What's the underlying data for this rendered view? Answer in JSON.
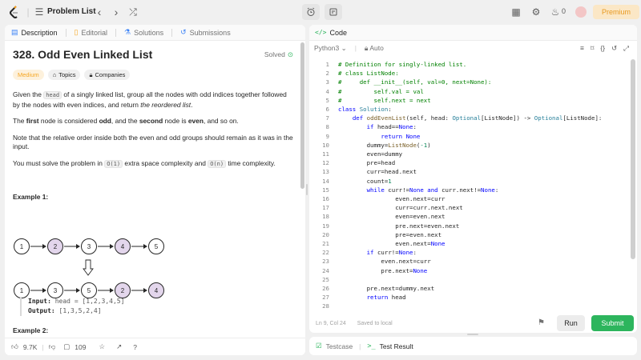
{
  "topbar": {
    "problem_list": "Problem List",
    "streak_count": "0",
    "premium": "Premium"
  },
  "left_tabs": [
    "Description",
    "Editorial",
    "Solutions",
    "Submissions"
  ],
  "problem": {
    "title": "328. Odd Even Linked List",
    "solved": "Solved",
    "difficulty": "Medium",
    "topics": "Topics",
    "companies": "Companies",
    "p1_a": "Given the ",
    "p1_code": "head",
    "p1_b": " of a singly linked list, group all the nodes with odd indices together followed by the nodes with even indices, and return ",
    "p1_em": "the reordered list",
    "p1_c": ".",
    "p2_a": "The ",
    "p2_b1": "first",
    "p2_b": " node is considered ",
    "p2_b2": "odd",
    "p2_c": ", and the ",
    "p2_b3": "second",
    "p2_d": " node is ",
    "p2_b4": "even",
    "p2_e": ", and so on.",
    "p3": "Note that the relative order inside both the even and odd groups should remain as it was in the input.",
    "p4_a": "You must solve the problem in ",
    "p4_code1": "O(1)",
    "p4_b": " extra space complexity and ",
    "p4_code2": "O(n)",
    "p4_c": " time complexity.",
    "example1_title": "Example 1:",
    "list_top": [
      "1",
      "2",
      "3",
      "4",
      "5"
    ],
    "list_bottom": [
      "1",
      "3",
      "5",
      "2",
      "4"
    ],
    "input_label": "Input:",
    "input_value": "head = [1,2,3,4,5]",
    "output_label": "Output:",
    "output_value": "[1,3,5,2,4]",
    "example2_title": "Example 2:"
  },
  "bottom": {
    "likes": "9.7K",
    "comments": "109"
  },
  "code_panel": {
    "title": "Code",
    "language": "Python3",
    "auto": "Auto",
    "cursor": "Ln 9, Col 24",
    "saved": "Saved to local",
    "run": "Run",
    "submit": "Submit"
  },
  "code_lines": [
    "# Definition for singly-linked list.",
    "# class ListNode:",
    "#     def __init__(self, val=0, next=None):",
    "#         self.val = val",
    "#         self.next = next",
    "class Solution:",
    "    def oddEvenList(self, head: Optional[ListNode]) -> Optional[ListNode]:",
    "        if head==None:",
    "            return None",
    "        dummy=ListNode(-1)",
    "        even=dummy",
    "        pre=head",
    "        curr=head.next",
    "        count=1",
    "        while curr!=None and curr.next!=None:",
    "                even.next=curr",
    "                curr=curr.next.next",
    "                even=even.next",
    "                pre.next=even.next",
    "                pre=even.next",
    "                even.next=None",
    "        if curr!=None:",
    "            even.next=curr",
    "            pre.next=None",
    "",
    "        pre.next=dummy.next",
    "        return head",
    ""
  ],
  "test_tabs": [
    "Testcase",
    "Test Result"
  ]
}
